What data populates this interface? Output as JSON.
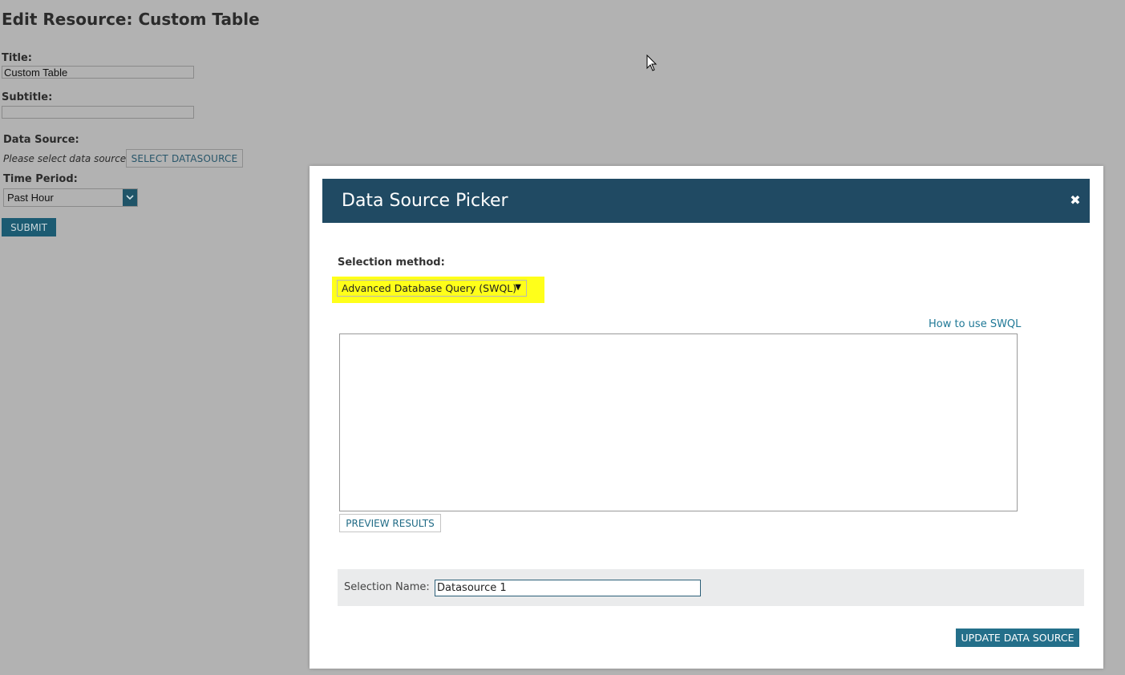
{
  "page": {
    "title": "Edit Resource: Custom Table",
    "title_label": "Title:",
    "title_value": "Custom Table",
    "subtitle_label": "Subtitle:",
    "subtitle_value": "",
    "data_source_label": "Data Source:",
    "data_source_placeholder": "Please select data source",
    "select_datasource_button": "SELECT DATASOURCE",
    "time_period_label": "Time Period:",
    "time_period_value": "Past Hour",
    "submit_button": "SUBMIT"
  },
  "modal": {
    "title": "Data Source Picker",
    "close_icon": "close-icon",
    "selection_method_label": "Selection method:",
    "selection_method_value": "Advanced Database Query (SWQL)",
    "howto_link": "How to use SWQL",
    "query_text": "",
    "preview_button": "PREVIEW RESULTS",
    "selection_name_label": "Selection Name:",
    "selection_name_value": "Datasource 1",
    "update_button": "UPDATE DATA SOURCE"
  },
  "colors": {
    "backdrop": "#b2b2b2",
    "header": "#204a63",
    "accent": "#246f8a",
    "highlight": "#ffff1a",
    "link": "#1f7896"
  }
}
